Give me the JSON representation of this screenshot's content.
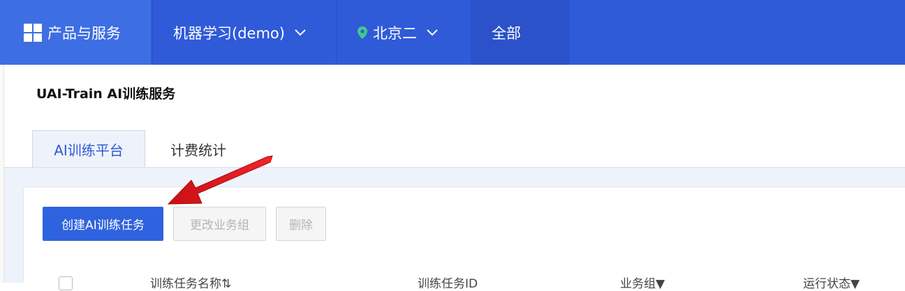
{
  "topnav": {
    "products_label": "产品与服务",
    "project_label": "机器学习(demo)",
    "region_label": "北京二",
    "all_label": "全部"
  },
  "page": {
    "title": "UAI-Train AI训练服务"
  },
  "tabs": [
    {
      "label": "AI训练平台",
      "active": true
    },
    {
      "label": "计费统计",
      "active": false
    }
  ],
  "toolbar": {
    "create_label": "创建AI训练任务",
    "change_group_label": "更改业务组",
    "delete_label": "删除"
  },
  "table": {
    "columns": [
      "训练任务名称⇅",
      "训练任务ID",
      "业务组▼",
      "运行状态▼"
    ]
  },
  "colors": {
    "nav_bg": "#2f5bd9",
    "primary": "#2f62de",
    "arrow": "#e8141b"
  },
  "icons": {
    "products": "grid-icon",
    "project": "chevron-down-icon",
    "region": "location-pin-icon"
  }
}
